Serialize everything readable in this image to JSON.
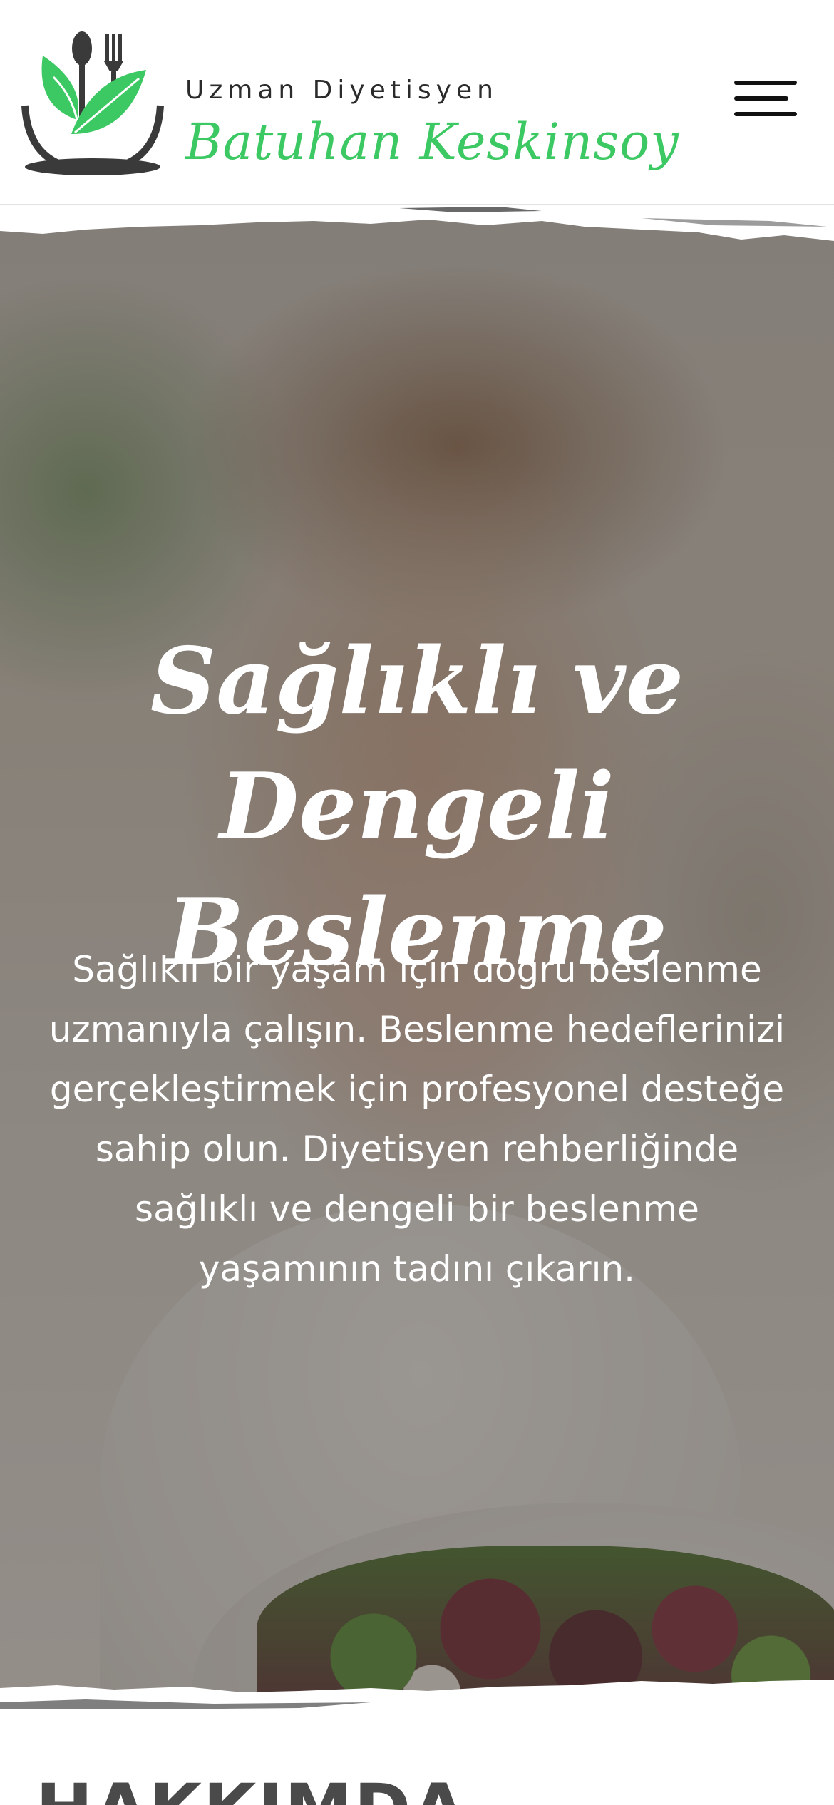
{
  "header": {
    "brand_subtitle": "Uzman Diyetisyen",
    "brand_name": "Batuhan Keskinsoy",
    "menu_icon": "hamburger-menu-icon",
    "logo_icon": "plate-leaf-cutlery-logo"
  },
  "hero": {
    "title": "Sağlıklı ve Dengeli Beslenme",
    "text": "Sağlıklı bir yaşam için doğru beslenme uzmanıyla çalışın. Beslenme hedeflerinizi gerçekleştirmek için profesyonel desteğe sahip olun. Diyetisyen rehberliğinde sağlıklı ve dengeli bir beslenme yaşamının tadını çıkarın."
  },
  "about": {
    "heading": "HAKKIMDA"
  },
  "colors": {
    "brand_green": "#3cc862",
    "logo_dark": "#3a3a3a",
    "text_dark": "#2b2b2b"
  }
}
